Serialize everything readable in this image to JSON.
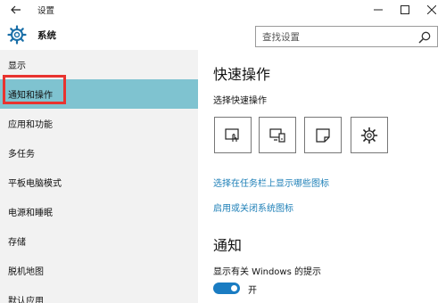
{
  "window": {
    "title": "设置"
  },
  "header": {
    "title": "系统",
    "search_placeholder": "查找设置"
  },
  "sidebar": {
    "items": [
      {
        "label": "显示"
      },
      {
        "label": "通知和操作"
      },
      {
        "label": "应用和功能"
      },
      {
        "label": "多任务"
      },
      {
        "label": "平板电脑模式"
      },
      {
        "label": "电源和睡眠"
      },
      {
        "label": "存储"
      },
      {
        "label": "脱机地图"
      },
      {
        "label": "默认应用"
      }
    ],
    "selected_index": 1,
    "highlight_color": "#e8332f",
    "selected_bg": "#7fc3d0"
  },
  "main": {
    "quick_actions_title": "快速操作",
    "quick_actions_subtitle": "选择快速操作",
    "quick_actions": [
      {
        "icon": "tablet-mode-icon"
      },
      {
        "icon": "connect-display-icon"
      },
      {
        "icon": "note-icon"
      },
      {
        "icon": "settings-icon"
      }
    ],
    "link_taskbar_icons": "选择在任务栏上显示哪些图标",
    "link_system_icons": "启用或关闭系统图标",
    "notifications_title": "通知",
    "windows_tips_label": "显示有关 Windows 的提示",
    "windows_tips_state": "开",
    "accent_color": "#1a7cc2",
    "link_color": "#1d7fb7"
  }
}
